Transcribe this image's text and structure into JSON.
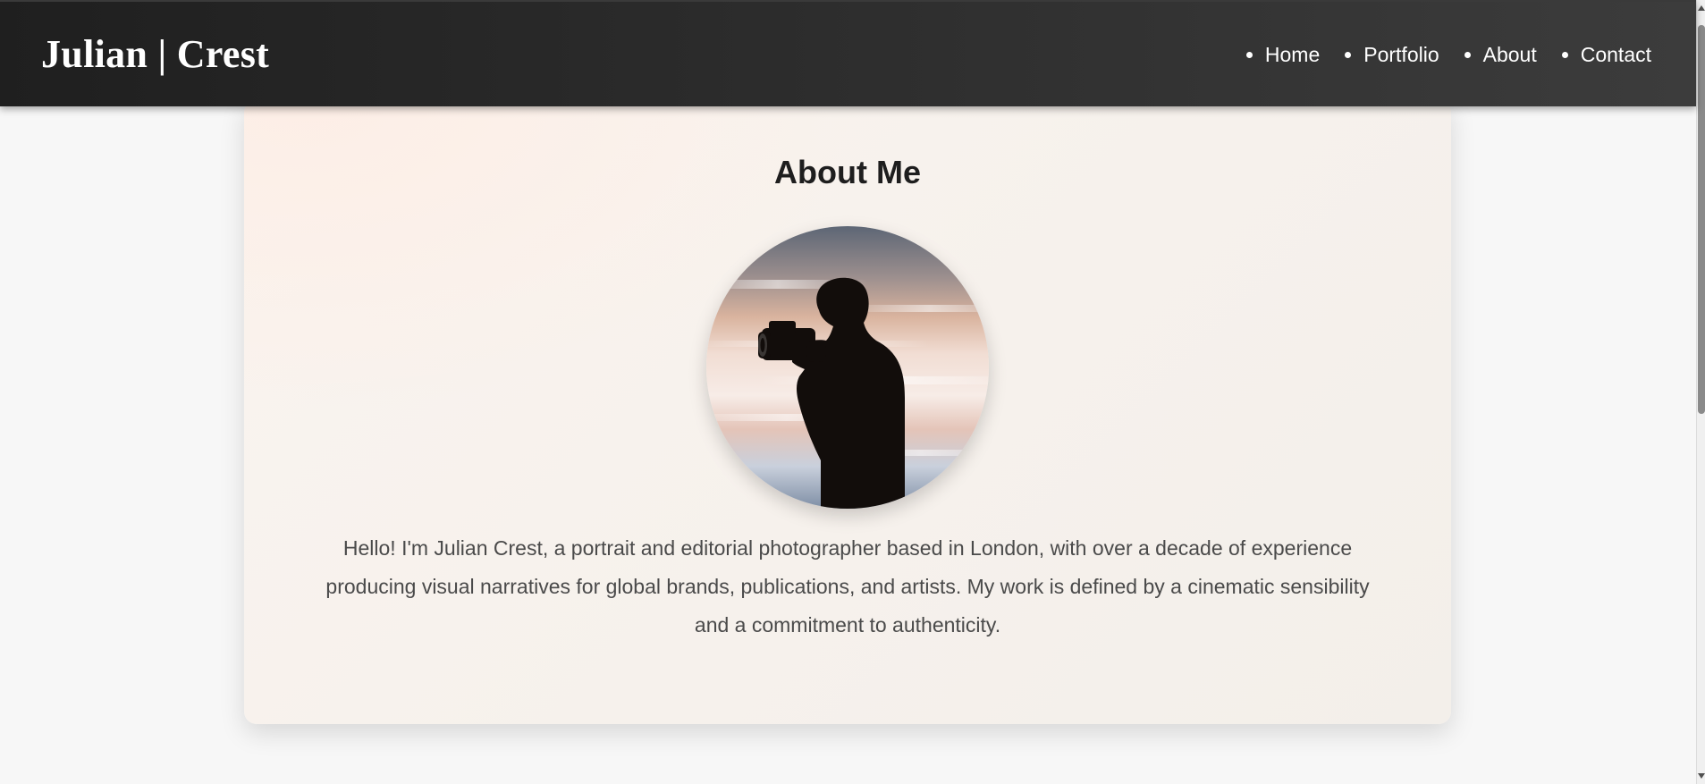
{
  "header": {
    "brand": "Julian | Crest",
    "nav": [
      {
        "label": "Home"
      },
      {
        "label": "Portfolio"
      },
      {
        "label": "About"
      },
      {
        "label": "Contact"
      }
    ]
  },
  "about": {
    "title": "About Me",
    "portrait_icon": "photographer-silhouette-photo",
    "bio": "Hello! I'm Julian Crest, a portrait and editorial photographer based in London, with over a decade of experience producing visual narratives for global brands, publications, and artists. My work is defined by a cinematic sensibility and a commitment to authenticity."
  },
  "colors": {
    "header_bg": "#2c2c2c",
    "page_bg": "#f7f7f7",
    "card_bg": "#f6f1ec",
    "title_text": "#1e1e1e",
    "body_text": "#4a4a4a"
  }
}
